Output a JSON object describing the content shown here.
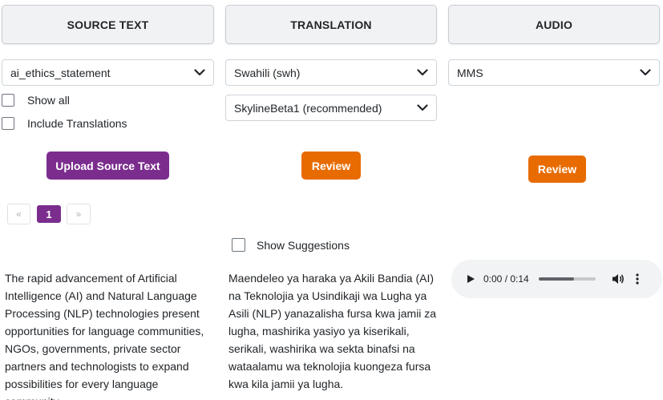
{
  "columns": {
    "source": {
      "header": "SOURCE TEXT",
      "select_value": "ai_ethics_statement",
      "show_all_label": "Show all",
      "include_translations_label": "Include Translations",
      "upload_button": "Upload Source Text",
      "pagination": {
        "prev": "«",
        "current": "1",
        "next": "»"
      },
      "body": "The rapid advancement of Artificial Intelligence (AI) and Natural Language Processing (NLP) technologies present opportunities for language communities, NGOs, governments, private sector partners and technologists to expand possibilities for every language community."
    },
    "translation": {
      "header": "TRANSLATION",
      "language_value": "Swahili (swh)",
      "model_value": "SkylineBeta1 (recommended)",
      "review_button": "Review",
      "show_suggestions_label": "Show Suggestions",
      "body": "Maendeleo ya haraka ya Akili Bandia (AI) na Teknolojia ya Usindikaji wa Lugha ya Asili (NLP) yanazalisha fursa kwa jamii za lugha, mashirika yasiyo ya kiserikali, serikali, washirika wa sekta binafsi na wataalamu wa teknolojia kuongeza fursa kwa kila jamii ya lugha."
    },
    "audio": {
      "header": "AUDIO",
      "select_value": "MMS",
      "review_button": "Review",
      "player": {
        "time": "0:00 / 0:14",
        "progress": 0.63,
        "icons": [
          "play-icon",
          "volume-icon",
          "more-options-icon"
        ]
      }
    }
  },
  "colors": {
    "accent_purple": "#7b2d8e",
    "accent_orange": "#e86b00",
    "header_bg": "#f1f2f4"
  }
}
